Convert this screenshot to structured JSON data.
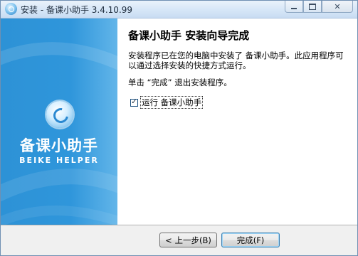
{
  "window": {
    "title": "安装 - 备课小助手 3.4.10.99",
    "minimize_icon": "minimize-icon",
    "maximize_icon": "maximize-icon",
    "close_icon": "close-icon"
  },
  "banner": {
    "logo_icon": "beike-helper-logo",
    "brand_cn": "备课小助手",
    "brand_en": "BEIKE HELPER"
  },
  "content": {
    "heading": "备课小助手 安装向导完成",
    "paragraph": "安装程序已在您的电脑中安装了 备课小助手。此应用程序可以通过选择安装的快捷方式运行。",
    "hint": "单击 “完成” 退出安装程序。",
    "run_checkbox": {
      "label": "运行 备课小助手",
      "checked": true
    }
  },
  "buttons": {
    "back": "< 上一步(B)",
    "finish": "完成(F)"
  },
  "colors": {
    "banner": "#2f96db",
    "title_bar": "#d6e6f7"
  }
}
